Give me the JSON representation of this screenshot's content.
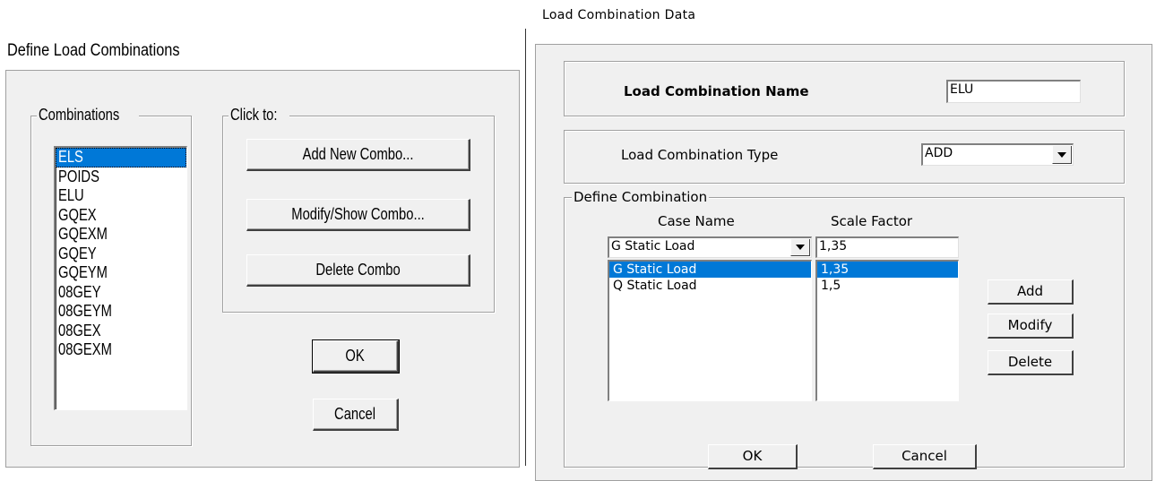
{
  "left_dialog": {
    "title": "Define Load Combinations",
    "combinations_legend": "Combinations",
    "combinations": [
      "ELS",
      "POIDS",
      "ELU",
      "GQEX",
      "GQEXM",
      "GQEY",
      "GQEYM",
      "08GEY",
      "08GEYM",
      "08GEX",
      "08GEXM"
    ],
    "selected_index": 0,
    "click_to_legend": "Click to:",
    "add_button": "Add New Combo...",
    "modify_button": "Modify/Show Combo...",
    "delete_button": "Delete Combo",
    "ok_button": "OK",
    "cancel_button": "Cancel"
  },
  "right_dialog": {
    "title": "Load Combination Data",
    "name_label": "Load Combination Name",
    "name_value": "ELU",
    "type_label": "Load Combination Type",
    "type_value": "ADD",
    "define_legend": "Define Combination",
    "case_header": "Case Name",
    "scale_header": "Scale Factor",
    "case_select": "G Static Load",
    "scale_input": "1,35",
    "cases": [
      "G Static Load",
      "Q Static Load"
    ],
    "scales": [
      "1,35",
      "1,5"
    ],
    "selected_case_index": 0,
    "add_button": "Add",
    "modify_button": "Modify",
    "delete_button": "Delete",
    "ok_button": "OK",
    "cancel_button": "Cancel"
  },
  "colors": {
    "selection": "#0078d7",
    "dialog_bg": "#f0f0f0"
  }
}
